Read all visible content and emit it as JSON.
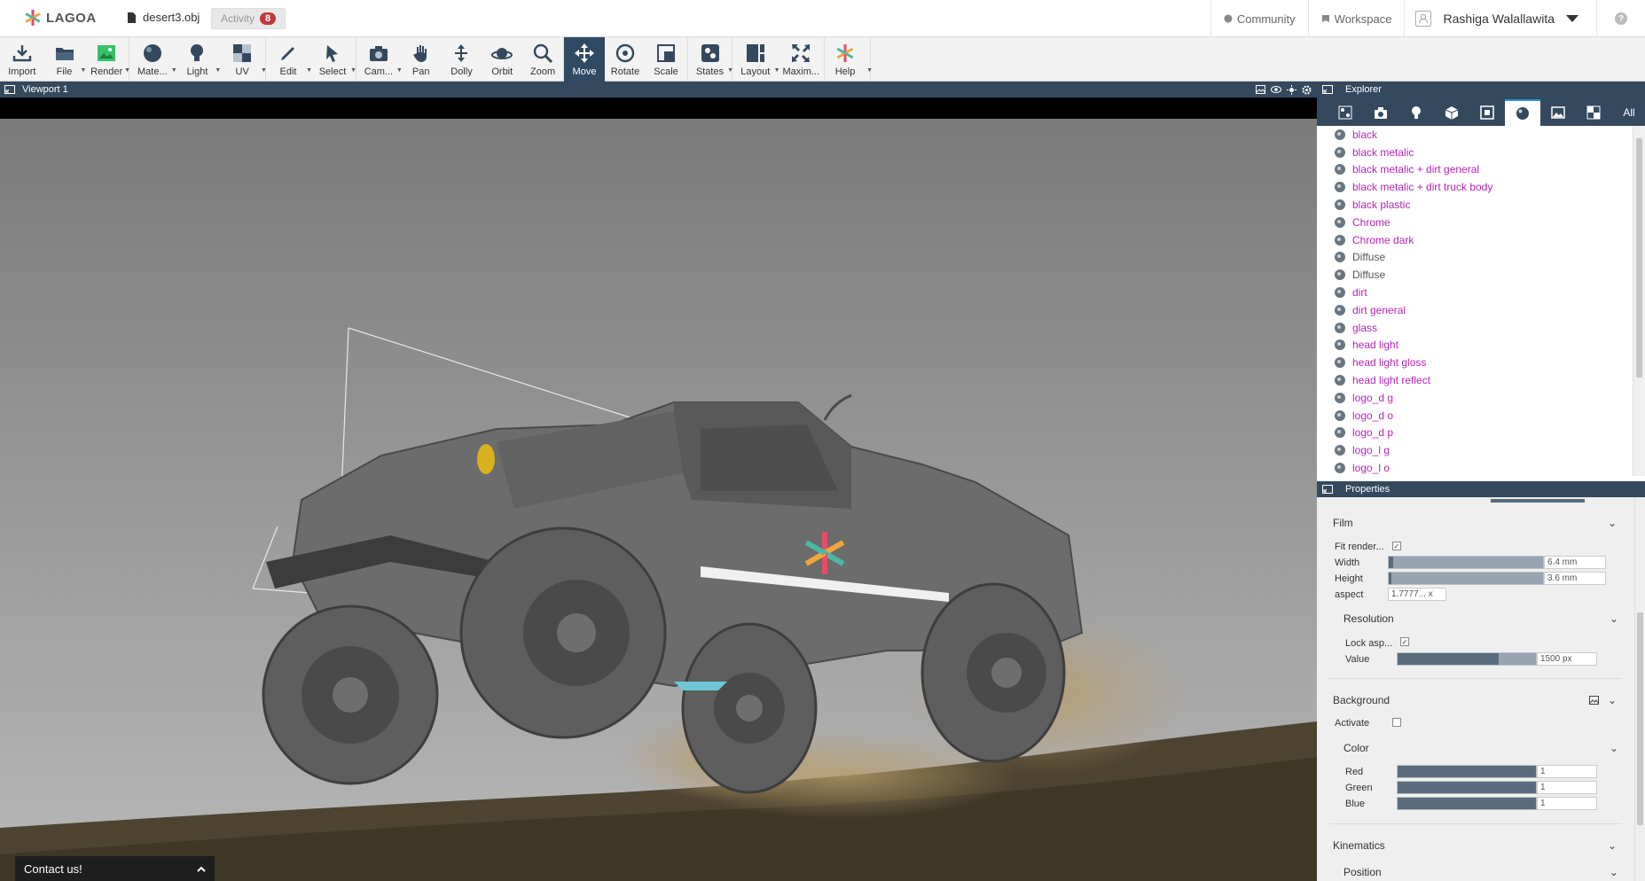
{
  "header": {
    "logo": "LAGOA",
    "document": "desert3.obj",
    "activity_label": "Activity",
    "activity_count": "8",
    "community": "Community",
    "workspace": "Workspace",
    "user": "Rashiga Walallawita"
  },
  "toolbar": {
    "items": [
      {
        "label": "Import",
        "icon": "import-icon"
      },
      {
        "label": "File",
        "icon": "folder-icon"
      },
      {
        "label": "Render",
        "icon": "render-icon"
      },
      {
        "label": "Mate...",
        "icon": "material-sphere-icon"
      },
      {
        "label": "Light",
        "icon": "light-bulb-icon"
      },
      {
        "label": "UV",
        "icon": "checker-icon"
      },
      {
        "label": "Edit",
        "icon": "pencil-icon"
      },
      {
        "label": "Select",
        "icon": "cursor-icon"
      },
      {
        "label": "Cam...",
        "icon": "camera-icon"
      },
      {
        "label": "Pan",
        "icon": "hand-icon"
      },
      {
        "label": "Dolly",
        "icon": "dolly-icon"
      },
      {
        "label": "Orbit",
        "icon": "orbit-icon"
      },
      {
        "label": "Zoom",
        "icon": "magnifier-icon"
      },
      {
        "label": "Move",
        "icon": "move-arrows-icon"
      },
      {
        "label": "Rotate",
        "icon": "rotate-icon"
      },
      {
        "label": "Scale",
        "icon": "scale-icon"
      },
      {
        "label": "States",
        "icon": "states-icon"
      },
      {
        "label": "Layout",
        "icon": "layout-icon"
      },
      {
        "label": "Maxim...",
        "icon": "maximize-icon"
      },
      {
        "label": "Help",
        "icon": "lagoa-flower-icon"
      }
    ]
  },
  "viewport": {
    "title": "Viewport 1",
    "contact": "Contact us!"
  },
  "explorer": {
    "title": "Explorer",
    "all_tab": "All",
    "materials": [
      {
        "name": "black",
        "style": "magenta"
      },
      {
        "name": "black metalic",
        "style": "magenta"
      },
      {
        "name": "black metalic + dirt general",
        "style": "magenta"
      },
      {
        "name": "black metalic + dirt truck body",
        "style": "magenta"
      },
      {
        "name": "black plastic",
        "style": "magenta"
      },
      {
        "name": "Chrome",
        "style": "magenta"
      },
      {
        "name": "Chrome dark",
        "style": "magenta"
      },
      {
        "name": "Diffuse",
        "style": "gray"
      },
      {
        "name": "Diffuse",
        "style": "gray"
      },
      {
        "name": "dirt",
        "style": "magenta"
      },
      {
        "name": "dirt general",
        "style": "magenta"
      },
      {
        "name": "glass",
        "style": "magenta"
      },
      {
        "name": "head light",
        "style": "magenta"
      },
      {
        "name": "head light gloss",
        "style": "magenta"
      },
      {
        "name": "head light reflect",
        "style": "magenta"
      },
      {
        "name": "logo_d g",
        "style": "magenta"
      },
      {
        "name": "logo_d o",
        "style": "magenta"
      },
      {
        "name": "logo_d p",
        "style": "magenta"
      },
      {
        "name": "logo_l g",
        "style": "magenta"
      },
      {
        "name": "logo_l o",
        "style": "magenta"
      }
    ]
  },
  "properties": {
    "title": "Properties",
    "film": {
      "label": "Film",
      "fit_render": "Fit render...",
      "width_label": "Width",
      "width_value": "6.4 mm",
      "width_fill": 0.03,
      "height_label": "Height",
      "height_value": "3.6 mm",
      "height_fill": 0.02,
      "aspect_label": "aspect",
      "aspect_value": "1.7777... x"
    },
    "resolution": {
      "label": "Resolution",
      "lock": "Lock asp...",
      "value_label": "Value",
      "value": "1500 px",
      "value_fill": 0.73
    },
    "background": {
      "label": "Background",
      "activate": "Activate",
      "color_label": "Color",
      "red_label": "Red",
      "red": "1",
      "green_label": "Green",
      "green": "1",
      "blue_label": "Blue",
      "blue": "1"
    },
    "kinematics": "Kinematics",
    "position": "Position"
  },
  "colors": {
    "accent": "#34495e",
    "material_link": "#b524b5",
    "active_tool": "#2f4a63"
  }
}
